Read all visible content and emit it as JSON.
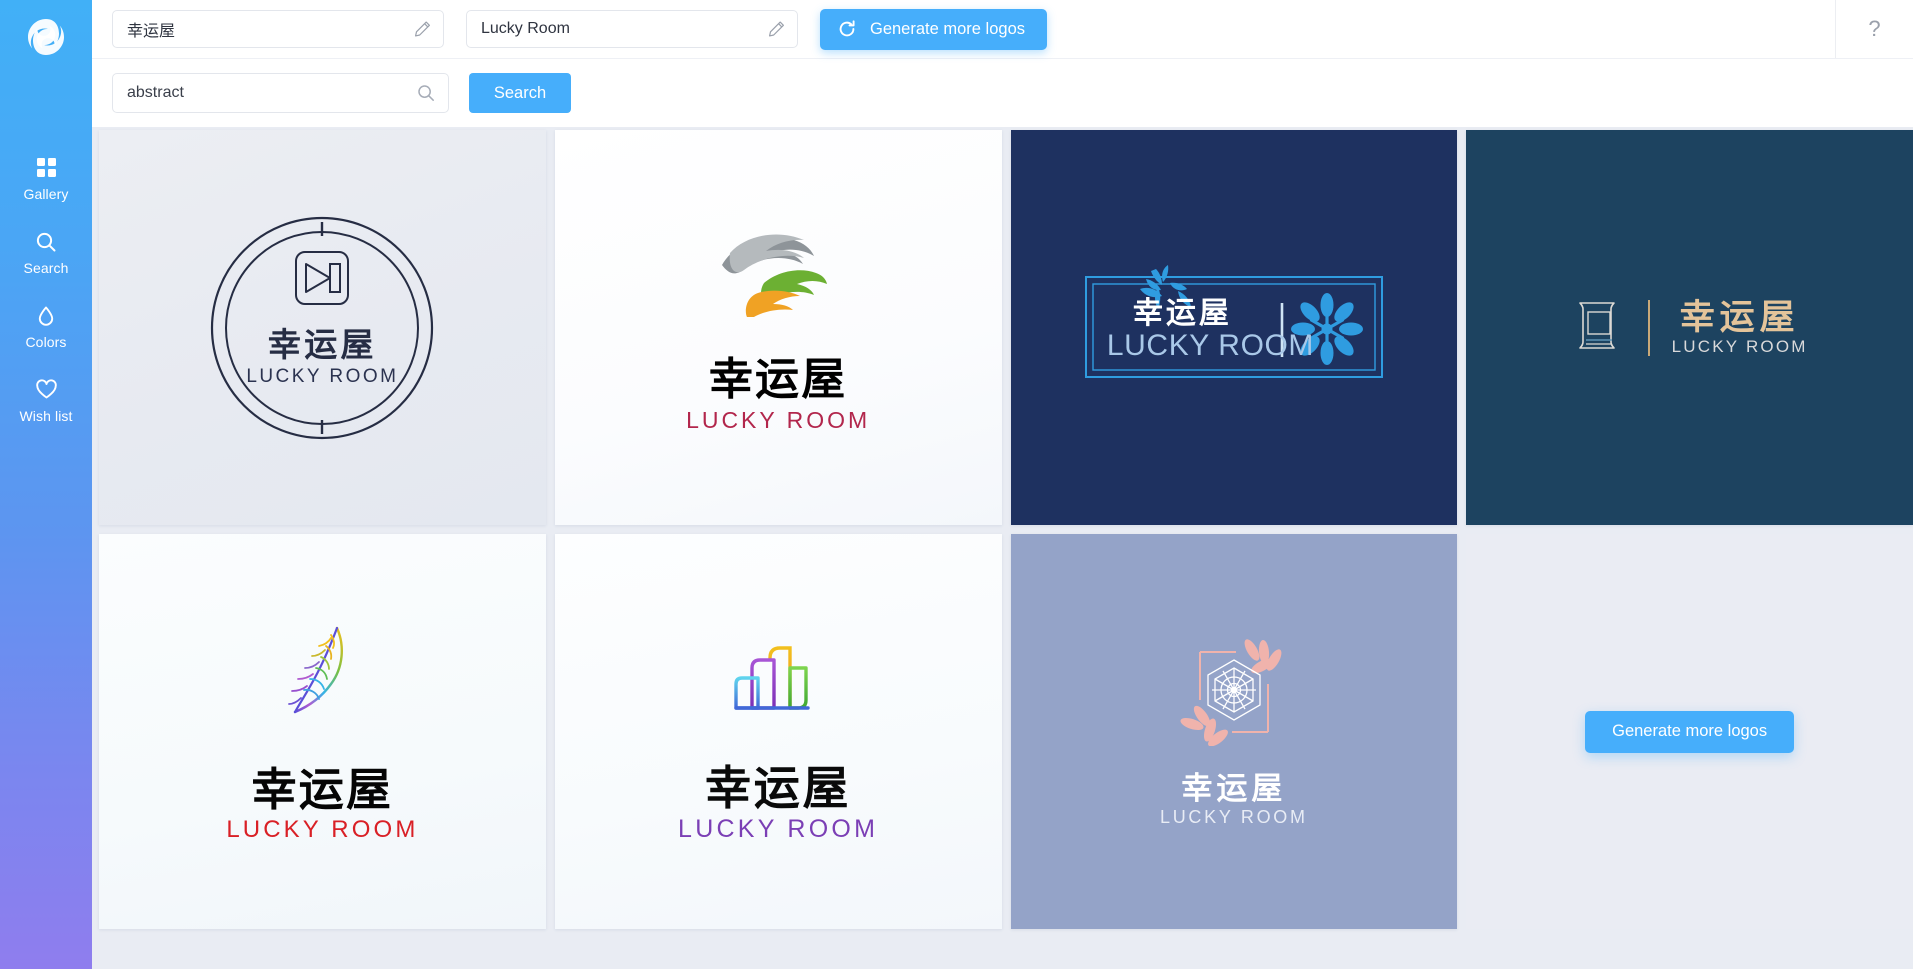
{
  "brand": {
    "logo_icon": "swirl-logo-icon"
  },
  "sidebar": {
    "items": [
      {
        "icon": "grid-icon",
        "label": "Gallery"
      },
      {
        "icon": "search-icon",
        "label": "Search"
      },
      {
        "icon": "droplet-icon",
        "label": "Colors"
      },
      {
        "icon": "heart-icon",
        "label": "Wish list"
      }
    ]
  },
  "topbar": {
    "company_name": {
      "value": "幸运屋",
      "edit_icon": "pencil-icon"
    },
    "slogan_name": {
      "value": "Lucky Room",
      "edit_icon": "pencil-icon"
    },
    "generate_button": {
      "label": "Generate more logos",
      "icon": "refresh-icon"
    },
    "help": {
      "label": "?",
      "icon": "question-mark-icon"
    }
  },
  "searchbar": {
    "input": {
      "value": "abstract",
      "placeholder": "abstract",
      "icon": "search-icon"
    },
    "button": {
      "label": "Search"
    }
  },
  "colors": {
    "accent": "#46aefb",
    "sidebar_top": "#41b0f7",
    "sidebar_bottom": "#8f7dee",
    "grid_background": "#e9ecf3"
  },
  "gallery": {
    "cards": [
      {
        "id": "logo-card-1",
        "style": "circular-emblem",
        "cn": "幸运屋",
        "en": "LUCKY ROOM",
        "background": "#eceef3",
        "mark_icon": "play-square-icon",
        "mark_color": "#262d44"
      },
      {
        "id": "logo-card-2",
        "style": "swirl-mark",
        "cn": "幸运屋",
        "en": "LUCKY ROOM",
        "background": "#ffffff",
        "mark_icon": "swirl-leaf-icon",
        "mark_color": "#8e9499"
      },
      {
        "id": "logo-card-3",
        "style": "framed-badge",
        "cn": "幸运屋",
        "en": "LUCKY ROOM",
        "background": "#1e3160",
        "mark_icon": "flower-mandala-icon",
        "mark_color": "#2f9ce0"
      },
      {
        "id": "logo-card-4",
        "style": "scroll-divider",
        "cn": "幸运屋",
        "en": "LUCKY ROOM",
        "background": "#1d4360",
        "mark_icon": "scroll-icon",
        "mark_color": "#e4c49a"
      },
      {
        "id": "logo-card-5",
        "style": "feather-mark",
        "cn": "幸运屋",
        "en": "LUCKY ROOM",
        "background": "#fbfdfe",
        "mark_icon": "feather-icon",
        "mark_color": "#f0a830"
      },
      {
        "id": "logo-card-6",
        "style": "buildings-mark",
        "cn": "幸运屋",
        "en": "LUCKY ROOM",
        "background": "#fdfeff",
        "mark_icon": "buildings-icon",
        "mark_color": "#9b51e0"
      },
      {
        "id": "logo-card-7",
        "style": "floral-frame",
        "cn": "幸运屋",
        "en": "LUCKY ROOM",
        "background": "#94a3c8",
        "mark_icon": "floral-frame-icon",
        "mark_color": "#f0b3ac"
      },
      {
        "id": "logo-card-8",
        "style": "placeholder",
        "background": "#eaecf3",
        "button_label": "Generate more logos"
      }
    ]
  }
}
